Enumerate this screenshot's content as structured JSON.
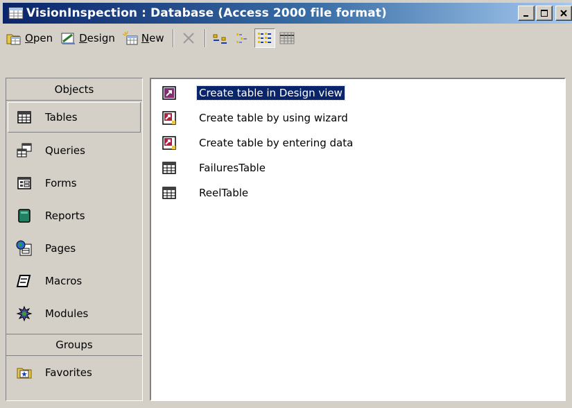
{
  "window": {
    "title": "VisionInspection : Database (Access 2000 file format)",
    "controls": {
      "minimize": "_",
      "maximize": "□",
      "close": "X"
    }
  },
  "toolbar": {
    "open_label": "Open",
    "open_accel": "O",
    "design_label": "Design",
    "design_accel": "D",
    "new_label": "New",
    "new_accel": "N"
  },
  "objects_pane": {
    "header": "Objects",
    "items": [
      {
        "label": "Tables",
        "icon": "table-icon",
        "selected": true
      },
      {
        "label": "Queries",
        "icon": "query-icon"
      },
      {
        "label": "Forms",
        "icon": "form-icon"
      },
      {
        "label": "Reports",
        "icon": "report-icon"
      },
      {
        "label": "Pages",
        "icon": "page-icon"
      },
      {
        "label": "Macros",
        "icon": "macro-icon"
      },
      {
        "label": "Modules",
        "icon": "module-icon"
      }
    ],
    "groups_header": "Groups",
    "groups": [
      {
        "label": "Favorites",
        "icon": "favorites-folder-icon"
      }
    ]
  },
  "list_pane": {
    "items": [
      {
        "label": "Create table in Design view",
        "icon": "shortcut-icon",
        "selected": true
      },
      {
        "label": "Create table by using wizard",
        "icon": "shortcut-icon"
      },
      {
        "label": "Create table by entering data",
        "icon": "shortcut-icon"
      },
      {
        "label": "FailuresTable",
        "icon": "table-icon"
      },
      {
        "label": "ReelTable",
        "icon": "table-icon"
      }
    ]
  },
  "colors": {
    "title_gradient_start": "#0a246a",
    "title_gradient_end": "#a6caf0",
    "face": "#d4d0c8",
    "selection": "#0a246a"
  }
}
